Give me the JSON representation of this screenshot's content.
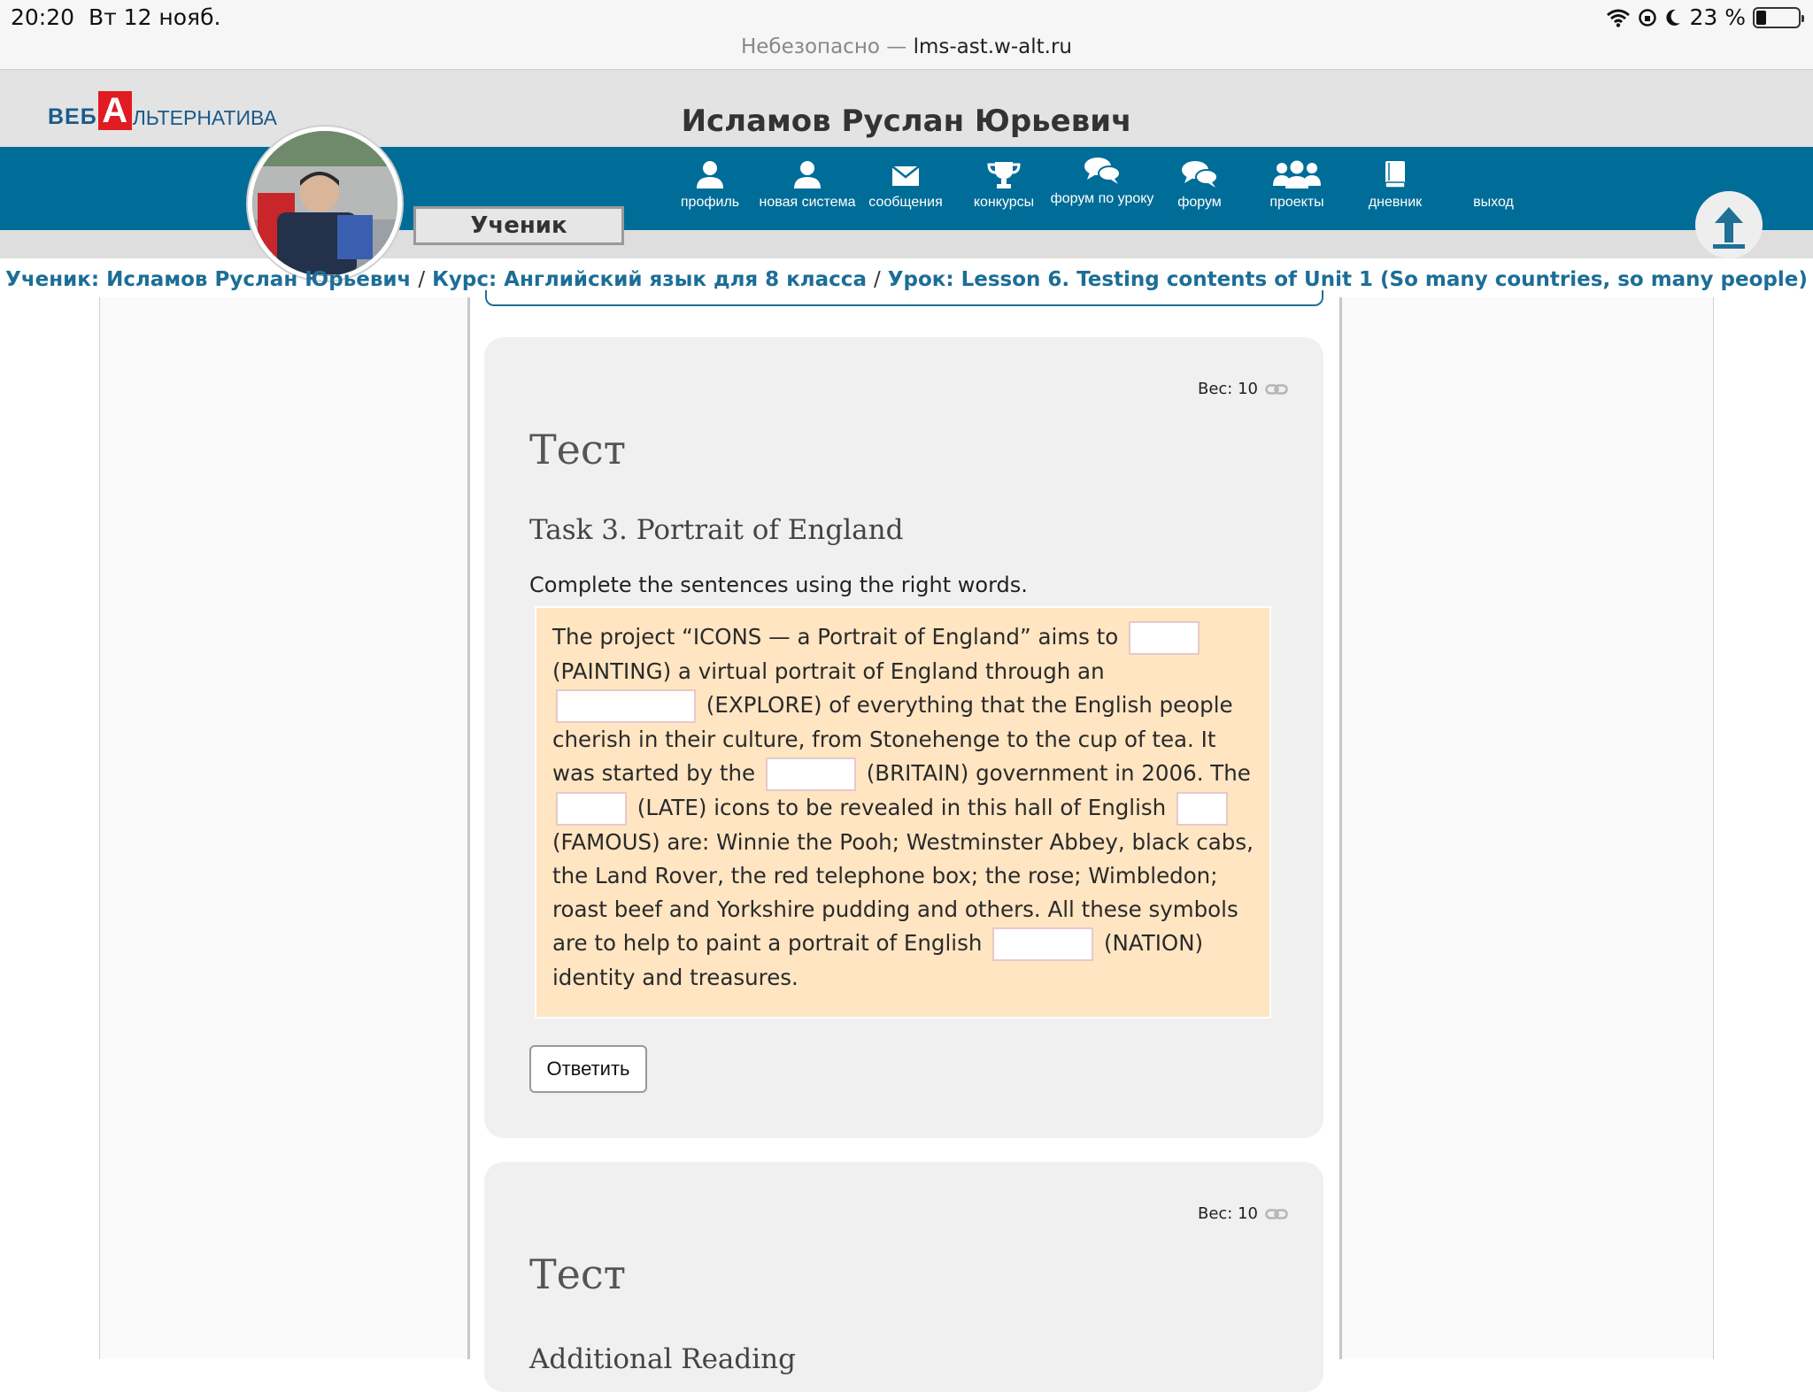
{
  "status_bar": {
    "time": "20:20",
    "date": "Вт 12 нояб.",
    "battery": "23 %",
    "battery_level": 0.23
  },
  "address_bar": {
    "insecure_label": "Небезопасно —",
    "domain": "lms-ast.w-alt.ru"
  },
  "logo": {
    "part1": "ВЕБ",
    "part2": "А",
    "part3": "ЛЬТЕРНАТИВА"
  },
  "header": {
    "user_name": "Исламов Руслан Юрьевич"
  },
  "role_button": "Ученик",
  "nav": [
    {
      "label": "профиль",
      "icon": "person-icon"
    },
    {
      "label": "новая система",
      "icon": "person-icon"
    },
    {
      "label": "сообщения",
      "icon": "envelope-icon"
    },
    {
      "label": "конкурсы",
      "icon": "trophy-icon"
    },
    {
      "label": "форум по уроку",
      "icon": "chat-bubbles-icon"
    },
    {
      "label": "форум",
      "icon": "chat-bubbles-icon"
    },
    {
      "label": "проекты",
      "icon": "group-icon"
    },
    {
      "label": "дневник",
      "icon": "book-icon"
    },
    {
      "label": "выход",
      "icon": ""
    }
  ],
  "breadcrumbs": {
    "student": "Ученик: Исламов Руслан Юрьевич",
    "course": "Курс: Английский язык для 8 класса",
    "lesson": "Урок: Lesson 6. Testing contents of Unit 1 (So many countries, so many people)",
    "separator": "/"
  },
  "card1": {
    "weight": "Вес: 10",
    "title": "Тест",
    "task_title": "Task 3. Portrait of England",
    "instruction": "Complete the sentences using the right words.",
    "text": {
      "s1": "The project “ICONS — a Portrait of England” aims to",
      "s2": "(PAINTING) a virtual portrait of England through an",
      "s3": "(EXPLORE) of everything that the English people cherish in their culture, from Stonehenge to the cup of tea. It was started by the",
      "s4": "(BRITAIN) government in 2006. The",
      "s5": "(LATE) icons to be revealed in this hall of English",
      "s6": "(FAMOUS) are: Winnie the Pooh; Westminster Abbey, black cabs, the Land Rover, the red telephone box; the rose; Wimbledon; roast beef and Yorkshire pudding and others. All these symbols are to help to paint a portrait of English",
      "s7": "(NATION) identity and treasures."
    },
    "answer_button": "Ответить"
  },
  "card2": {
    "weight": "Вес: 10",
    "title": "Тест",
    "task_title": "Additional Reading"
  }
}
